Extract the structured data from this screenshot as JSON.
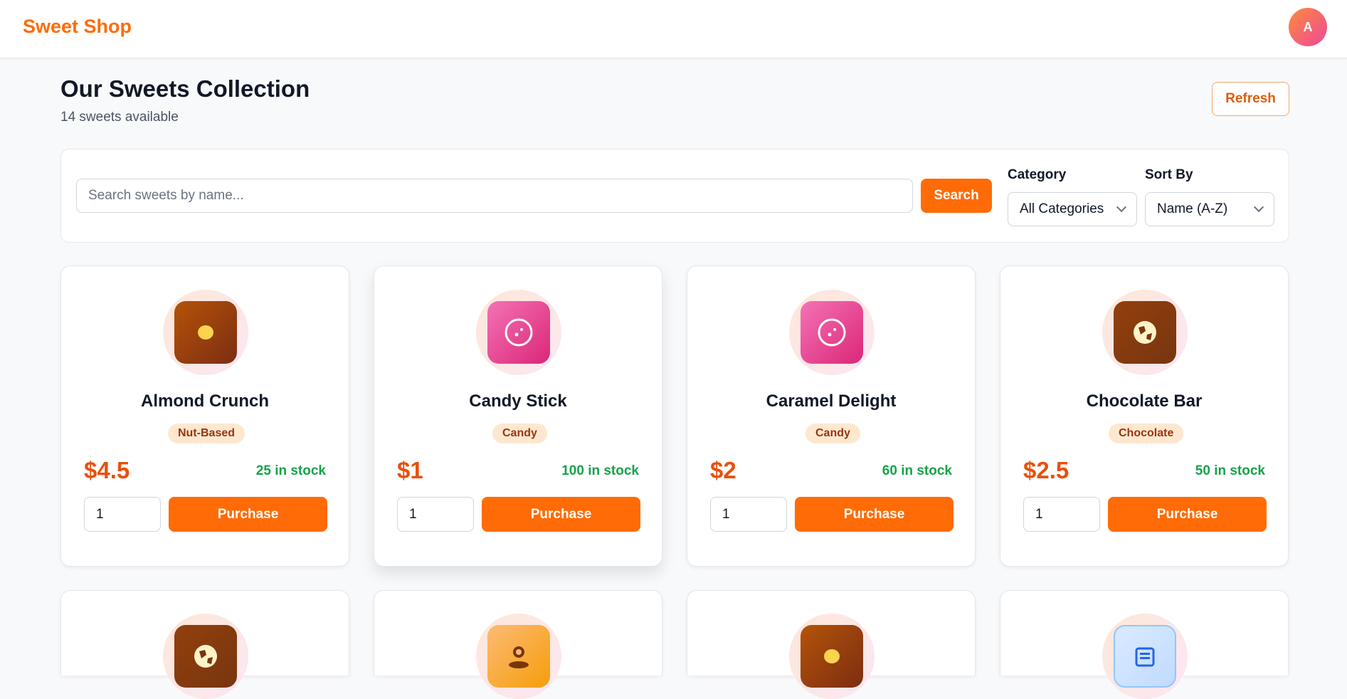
{
  "header": {
    "brand": "Sweet Shop",
    "avatar_initial": "A"
  },
  "page": {
    "title": "Our Sweets Collection",
    "subtitle": "14 sweets available",
    "refresh_label": "Refresh"
  },
  "filters": {
    "search_placeholder": "Search sweets by name...",
    "search_value": "",
    "search_button": "Search",
    "category_label": "Category",
    "category_value": "All Categories",
    "sort_label": "Sort By",
    "sort_value": "Name (A-Z)"
  },
  "products": [
    {
      "name": "Almond Crunch",
      "category": "Nut-Based",
      "price": "$4.5",
      "stock": "25 in stock",
      "qty": "1",
      "purchase_label": "Purchase",
      "icon": "cookie-icon"
    },
    {
      "name": "Candy Stick",
      "category": "Candy",
      "price": "$1",
      "stock": "100 in stock",
      "qty": "1",
      "purchase_label": "Purchase",
      "icon": "candy-icon"
    },
    {
      "name": "Caramel Delight",
      "category": "Candy",
      "price": "$2",
      "stock": "60 in stock",
      "qty": "1",
      "purchase_label": "Purchase",
      "icon": "candy-icon"
    },
    {
      "name": "Chocolate Bar",
      "category": "Chocolate",
      "price": "$2.5",
      "stock": "50 in stock",
      "qty": "1",
      "purchase_label": "Purchase",
      "icon": "chocolate-icon"
    }
  ],
  "more_products_icons": [
    "chocolate-icon",
    "cupcake-icon",
    "cookie-icon",
    "cake-icon"
  ],
  "colors": {
    "accent": "#ff6b06",
    "price": "#e8500c",
    "stock": "#16a34a",
    "badge_bg": "#fde8cf",
    "badge_text": "#9a3412"
  }
}
